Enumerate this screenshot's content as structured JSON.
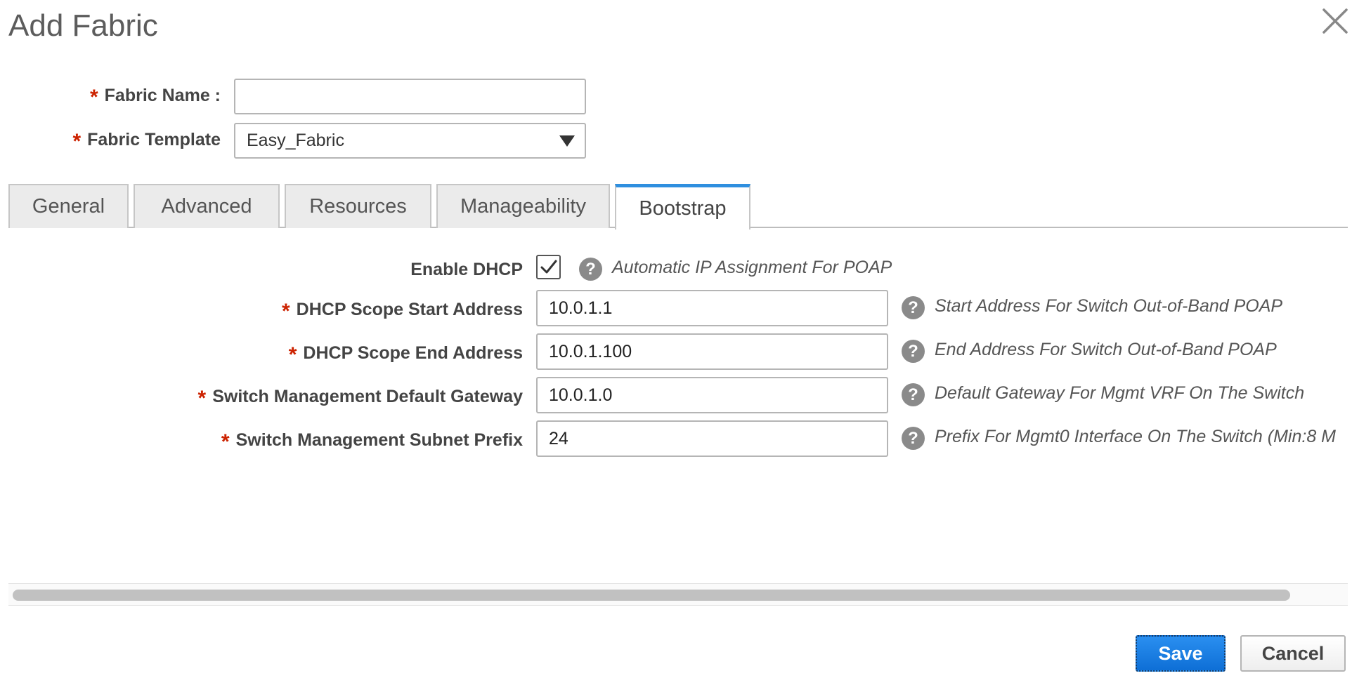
{
  "dialog": {
    "title": "Add Fabric"
  },
  "fabric_name": {
    "label": "Fabric Name :",
    "value": "",
    "placeholder": ""
  },
  "fabric_template": {
    "label": "Fabric Template",
    "selected": "Easy_Fabric"
  },
  "tabs": [
    {
      "label": "General",
      "active": false
    },
    {
      "label": "Advanced",
      "active": false
    },
    {
      "label": "Resources",
      "active": false
    },
    {
      "label": "Manageability",
      "active": false
    },
    {
      "label": "Bootstrap",
      "active": true
    }
  ],
  "bootstrap": {
    "enable_dhcp": {
      "label": "Enable DHCP",
      "checked": true,
      "hint": "Automatic IP Assignment For POAP"
    },
    "fields": [
      {
        "label": "DHCP Scope Start Address",
        "value": "10.0.1.1",
        "hint": "Start Address For Switch Out-of-Band POAP"
      },
      {
        "label": "DHCP Scope End Address",
        "value": "10.0.1.100",
        "hint": "End Address For Switch Out-of-Band POAP"
      },
      {
        "label": "Switch Management Default Gateway",
        "value": "10.0.1.0",
        "hint": "Default Gateway For Mgmt VRF On The Switch"
      },
      {
        "label": "Switch Management Subnet Prefix",
        "value": "24",
        "hint": "Prefix For Mgmt0 Interface On The Switch (Min:8 M"
      }
    ]
  },
  "required_marker": "*",
  "help_glyph": "?",
  "footer": {
    "save_label": "Save",
    "cancel_label": "Cancel"
  },
  "colors": {
    "accent": "#2f8fdf",
    "required": "#cc2200",
    "save_button": "#1a7fe6"
  }
}
